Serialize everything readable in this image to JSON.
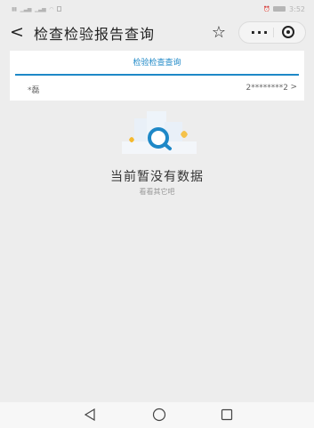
{
  "status_bar": {
    "left_icons": [
      "carrier-icon",
      "signal-icon",
      "signal-icon",
      "wifi-icon",
      "notification-icon"
    ],
    "time": "3:52",
    "battery_label": "",
    "right_icons": [
      "alarm-icon",
      "battery-icon"
    ]
  },
  "nav": {
    "back_glyph": "<",
    "title": "检查检验报告查询",
    "star_glyph": "☆",
    "more_glyph": "···"
  },
  "card": {
    "tab_label": "检验检查查询",
    "row_name": "*磊",
    "row_id": "2********2",
    "row_chevron": ">"
  },
  "empty": {
    "title": "当前暂没有数据",
    "subtitle": "看看其它吧"
  },
  "colors": {
    "accent": "#1e88c7",
    "background": "#ededed"
  }
}
